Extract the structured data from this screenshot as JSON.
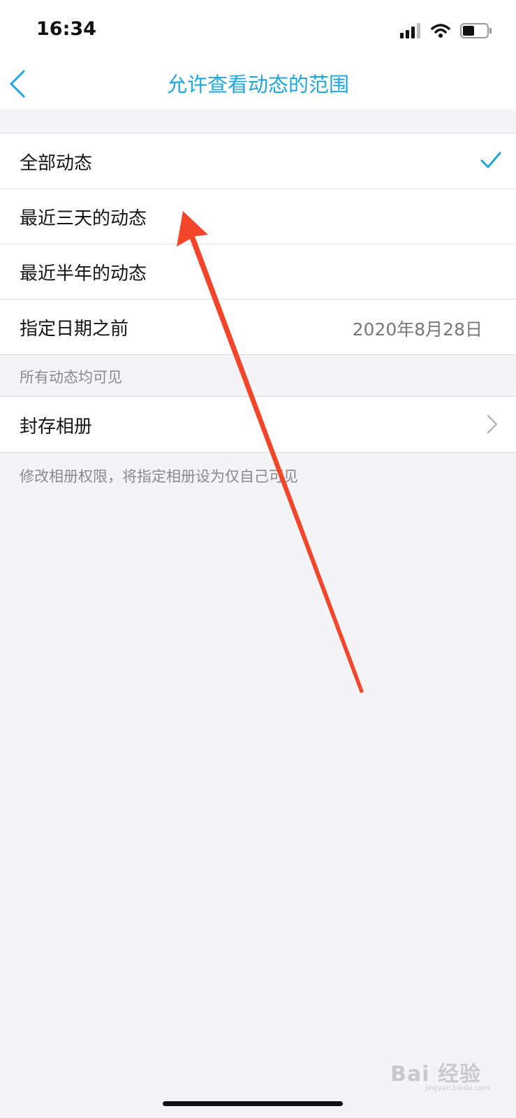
{
  "status_bar": {
    "time": "16:34",
    "icons": [
      "signal-icon",
      "wifi-icon",
      "battery-icon"
    ]
  },
  "nav": {
    "title": "允许查看动态的范围",
    "back_icon": "chevron-left-icon"
  },
  "range_options": [
    {
      "label": "全部动态",
      "selected": true
    },
    {
      "label": "最近三天的动态",
      "selected": false
    },
    {
      "label": "最近半年的动态",
      "selected": false
    },
    {
      "label": "指定日期之前",
      "value": "2020年8月28日",
      "selected": false
    }
  ],
  "range_note": "所有动态均可见",
  "album": {
    "label": "封存相册",
    "note": "修改相册权限，将指定相册设为仅自己可见"
  },
  "watermark": {
    "brand": "Bai 经验",
    "url": "jingyan.baidu.com"
  },
  "colors": {
    "accent": "#1fa6dc",
    "annotation_arrow": "#f2452a",
    "background": "#f4f4f6"
  }
}
